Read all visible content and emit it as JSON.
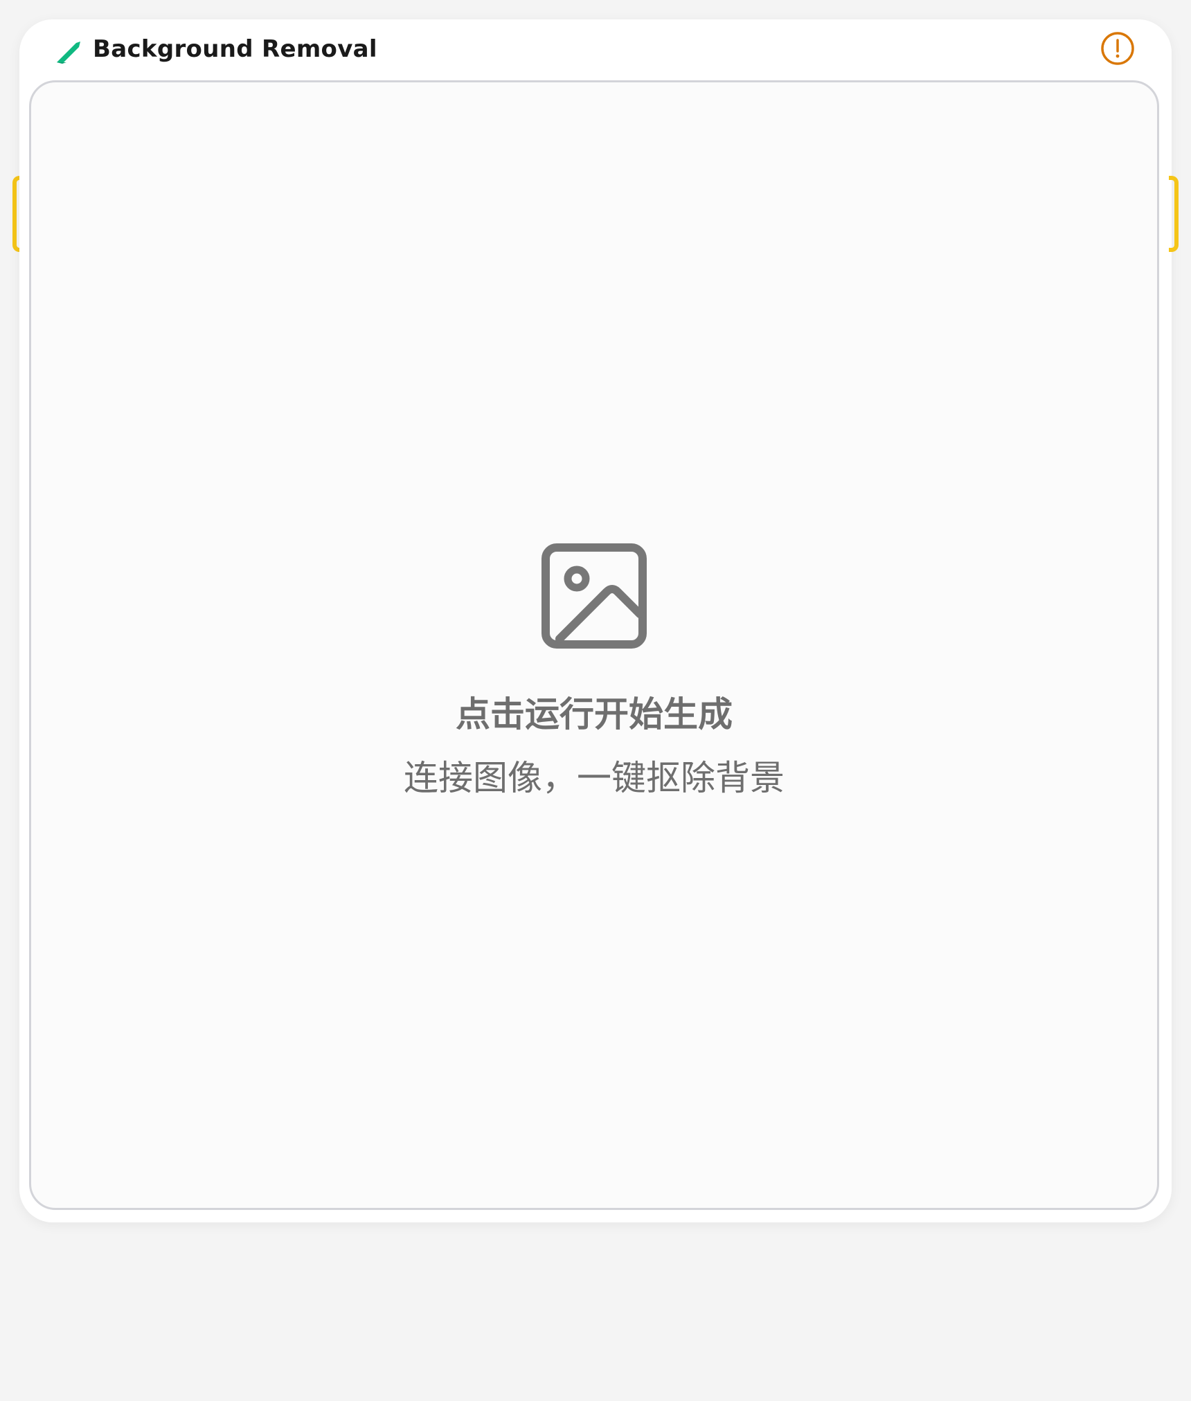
{
  "node": {
    "title": "Background Removal",
    "icon": "leaf-icon",
    "accent_color": "#10b981",
    "warning_icon": "exclamation-circle-icon",
    "warning_color": "#d97706"
  },
  "preview": {
    "icon": "image-icon",
    "message": "点击运行开始生成",
    "hint": "连接图像，一键抠除背景"
  },
  "connectors": {
    "color": "#f5c518"
  }
}
